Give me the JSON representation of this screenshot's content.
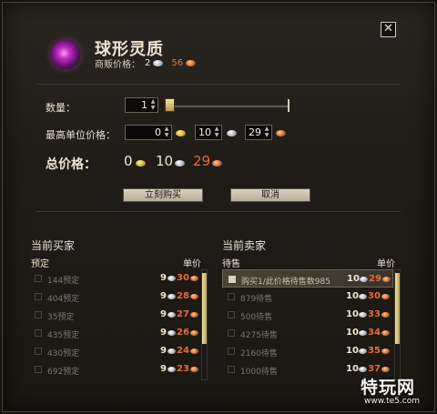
{
  "window": {
    "close_label": "✕"
  },
  "item": {
    "name": "球形灵质",
    "vendor_label": "商贩价格：",
    "vendor_silver": "2",
    "vendor_copper": "56"
  },
  "quantity": {
    "label": "数量：",
    "value": "1",
    "slider_level": 0
  },
  "max_unit_price": {
    "label": "最高单位价格：",
    "gold": "0",
    "silver": "10",
    "copper": "29"
  },
  "total": {
    "label": "总价格：",
    "gold": "0",
    "silver": "10",
    "copper": "29"
  },
  "buttons": {
    "buy": "立刻购买",
    "cancel": "取消"
  },
  "buyers": {
    "title": "当前买家",
    "col_left": "预定",
    "col_right": "单价",
    "rows": [
      {
        "name": "144预定",
        "silver": "9",
        "copper": "30"
      },
      {
        "name": "404预定",
        "silver": "9",
        "copper": "28"
      },
      {
        "name": "35预定",
        "silver": "9",
        "copper": "27"
      },
      {
        "name": "435预定",
        "silver": "9",
        "copper": "26"
      },
      {
        "name": "430预定",
        "silver": "9",
        "copper": "24"
      },
      {
        "name": "692预定",
        "silver": "9",
        "copper": "23"
      }
    ]
  },
  "sellers": {
    "title": "当前卖家",
    "col_left": "待售",
    "col_right": "单价",
    "rows": [
      {
        "name": "购买1/此价格待售数985",
        "silver": "10",
        "copper": "29"
      },
      {
        "name": "879待售",
        "silver": "10",
        "copper": "30"
      },
      {
        "name": "500待售",
        "silver": "10",
        "copper": "33"
      },
      {
        "name": "4275待售",
        "silver": "10",
        "copper": "34"
      },
      {
        "name": "2160待售",
        "silver": "10",
        "copper": "35"
      },
      {
        "name": "1000待售",
        "silver": "10",
        "copper": "37"
      }
    ]
  },
  "watermark": {
    "text": "特玩网",
    "url": "www.te5.com"
  },
  "colors": {
    "copper": "#e66b36",
    "gold": "#d3a623",
    "silver": "#a9b1bb",
    "panel": "#1f1c17"
  }
}
